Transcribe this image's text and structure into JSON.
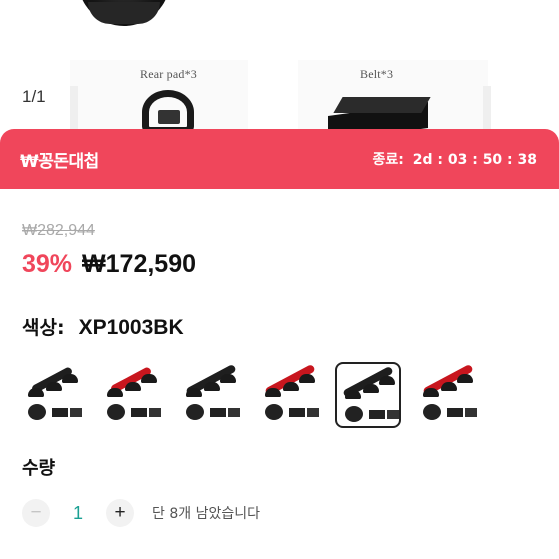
{
  "gallery": {
    "counter": "1/1",
    "captions": [
      "Rear pad*3",
      "Belt*3"
    ]
  },
  "deal": {
    "logo_text": "₩꽁돈대첩",
    "timer_label": "종료:",
    "timer_value": "2d : 03 : 50 : 38",
    "color": "#f0465b"
  },
  "pricing": {
    "original_price": "₩282,944",
    "discount": "39%",
    "sale_price": "₩172,590"
  },
  "color_option": {
    "label": "색상:",
    "value": "XP1003BK",
    "swatches": [
      {
        "color": "black",
        "selected": false
      },
      {
        "color": "red",
        "selected": false
      },
      {
        "color": "black",
        "selected": false
      },
      {
        "color": "red",
        "selected": false
      },
      {
        "color": "black",
        "selected": true
      },
      {
        "color": "red",
        "selected": false
      }
    ]
  },
  "quantity": {
    "label": "수량",
    "value": "1",
    "minus_icon": "minus-icon",
    "plus_icon": "plus-icon",
    "stock_text": "단 8개 남았습니다"
  }
}
